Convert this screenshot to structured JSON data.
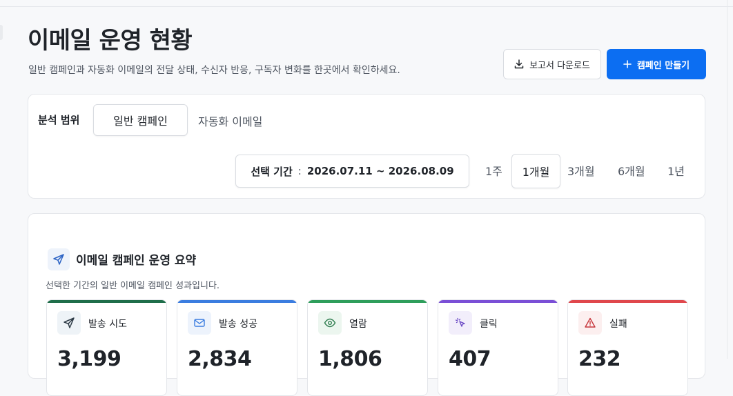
{
  "header": {
    "title": "이메일 운영 현황",
    "subtitle": "일반 캠페인과 자동화 이메일의 전달 상태, 수신자 반응, 구독자 변화를 한곳에서 확인하세요.",
    "report_button": "보고서 다운로드",
    "create_button": "캠페인 만들기",
    "report_icon": "download-icon",
    "create_icon": "plus-icon"
  },
  "filters": {
    "scope_label": "분석 범위",
    "scope_options": [
      "일반 캠페인",
      "자동화 이메일"
    ],
    "scope_selected": "일반 캠페인",
    "date_label": "선택 기간",
    "date_range": "2026.07.11 ~ 2026.08.09",
    "periods": [
      "1주",
      "1개월",
      "3개월",
      "6개월",
      "1년"
    ],
    "period_selected": "1개월"
  },
  "summary": {
    "icon": "send-icon",
    "title": "이메일 캠페인 운영 요약",
    "description": "선택한 기간의 일반 이메일 캠페인 성과입니다.",
    "metrics": [
      {
        "label": "발송 시도",
        "value": "3,199",
        "icon": "send-icon",
        "color": "#1f6e4a"
      },
      {
        "label": "발송 성공",
        "value": "2,834",
        "icon": "mail-check-icon",
        "color": "#3b7de0"
      },
      {
        "label": "열람",
        "value": "1,806",
        "icon": "eye-icon",
        "color": "#2e9e5b"
      },
      {
        "label": "클릭",
        "value": "407",
        "icon": "cursor-click-icon",
        "color": "#7a4fd6"
      },
      {
        "label": "실패",
        "value": "232",
        "icon": "warning-icon",
        "color": "#e0474c"
      }
    ]
  }
}
